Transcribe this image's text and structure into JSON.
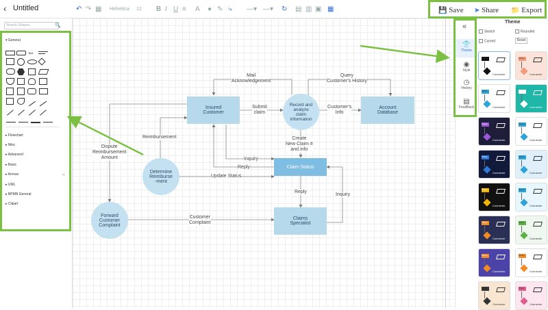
{
  "header": {
    "back_icon": "chevron-left-icon",
    "title": "Untitled",
    "toolbar_font": "Helvetica",
    "toolbar_size": "12",
    "save_label": "Save",
    "share_label": "Share",
    "export_label": "Export"
  },
  "left_panel": {
    "search_placeholder": "Search Shapes",
    "general": "General",
    "categories": [
      "Flowchart",
      "Misc",
      "Advanced",
      "Basic",
      "Arrows",
      "UML",
      "BPMN General",
      "Clipart"
    ],
    "text_shape": "Text"
  },
  "diagram": {
    "insured": "Insured\nCustomer",
    "record": "Record and\nanalyze\nclaim\ninformation",
    "account": "Account\nDatabase",
    "determine": "Determine\nReimburse\n-ment",
    "claim_status": "Claim Status",
    "forward": "Forward\nCustomer\nComplaint",
    "specialist": "Claims\nSpecialist",
    "l_mail": "Mail\nAcknowledgement",
    "l_query": "Query\nCustomer's History",
    "l_submit": "Submit\nclaim",
    "l_info": "Customer's\nInfo",
    "l_reimb": "Reimbursement",
    "l_dispute": "Dispute\nReimbursement\nAmount",
    "l_create": "Create\nNew Claim #\nand info",
    "l_inquiry1": "Inquiry",
    "l_reply1": "Reply",
    "l_update": "Update Status",
    "l_reply2": "Reply",
    "l_inquiry2": "Inquiry",
    "l_complaint": "Customer\nComplaint"
  },
  "right_sidebar": {
    "items": [
      {
        "label": "Theme",
        "icon": "shirt-icon"
      },
      {
        "label": "Style",
        "icon": "palette-icon"
      },
      {
        "label": "History",
        "icon": "clock-icon"
      },
      {
        "label": "FeedBack",
        "icon": "chat-icon"
      }
    ]
  },
  "theme_panel": {
    "title": "Theme",
    "sketch": "Sketch",
    "rounded": "Rounded",
    "curved": "Curved",
    "reset": "Reset",
    "card_shape_label": "Shape",
    "card_connector_label": "Connector",
    "card_bg_colors": [
      "#ffffff",
      "#fbe3d9",
      "#ffffff",
      "#1fb7a8",
      "#1e1e3a",
      "#ffffff",
      "#121a3c",
      "#dff0fb",
      "#111111",
      "#e8f6fd",
      "#2a2f55",
      "#eef8ee",
      "#4b43a8",
      "#ffffff",
      "#f8e6d3",
      "#fde6ef"
    ]
  }
}
